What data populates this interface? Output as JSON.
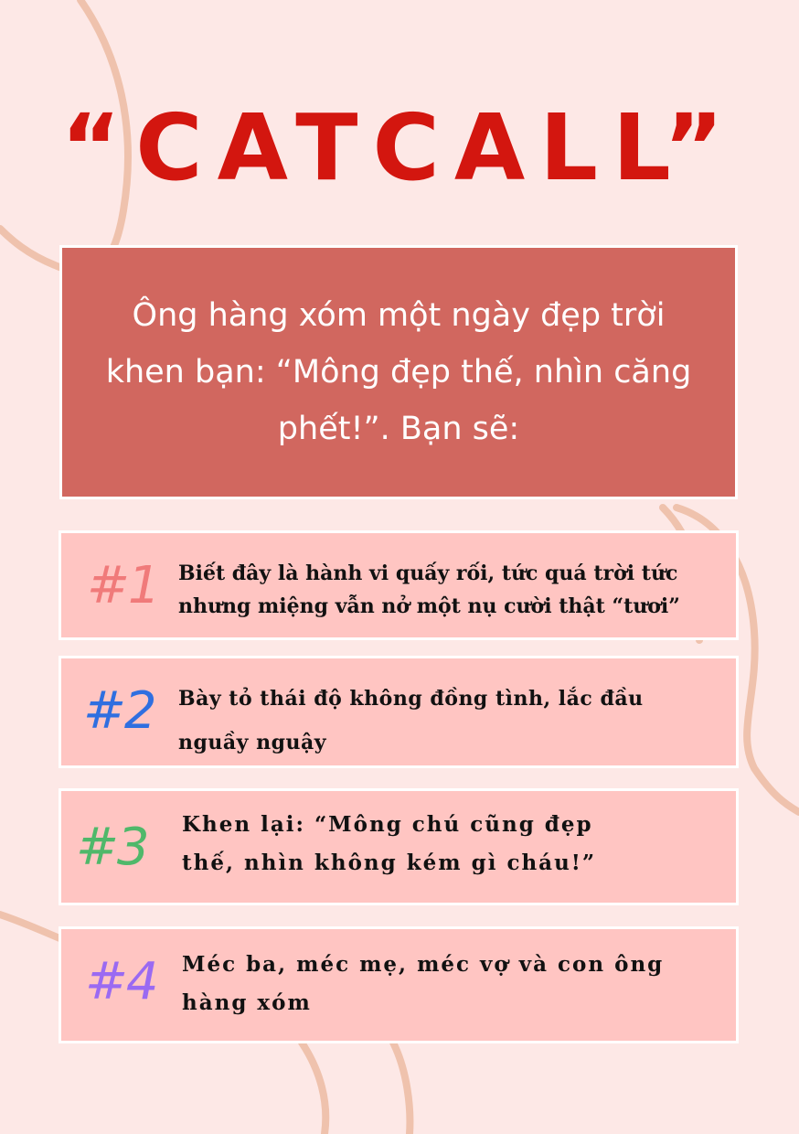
{
  "title": "“CATCALL”",
  "question": "Ông hàng xóm một ngày đẹp trời khen bạn: “Mông đẹp thế, nhìn căng phết!”. Bạn sẽ:",
  "options": [
    {
      "number": "#1",
      "text": "Biết đây là hành vi quấy rối, tức quá trời tức nhưng miệng vẫn nở một nụ cười thật “tươi”",
      "color": "#f07a7a"
    },
    {
      "number": "#2",
      "text": "Bày tỏ thái độ không đồng tình, lắc đầu nguầy nguậy",
      "color": "#2f6fe0"
    },
    {
      "number": "#3",
      "text": "Khen lại: “Mông chú cũng đẹp thế, nhìn không kém gì cháu!”",
      "color": "#4fb86a"
    },
    {
      "number": "#4",
      "text": "Méc ba, méc mẹ, méc vợ và con ông hàng xóm",
      "color": "#9a6af2"
    }
  ],
  "colors": {
    "background": "#fde8e6",
    "title": "#d3160f",
    "question_card": "#d1675f",
    "option_card": "#ffc5c2",
    "decor_lines": "#efc2ad"
  }
}
